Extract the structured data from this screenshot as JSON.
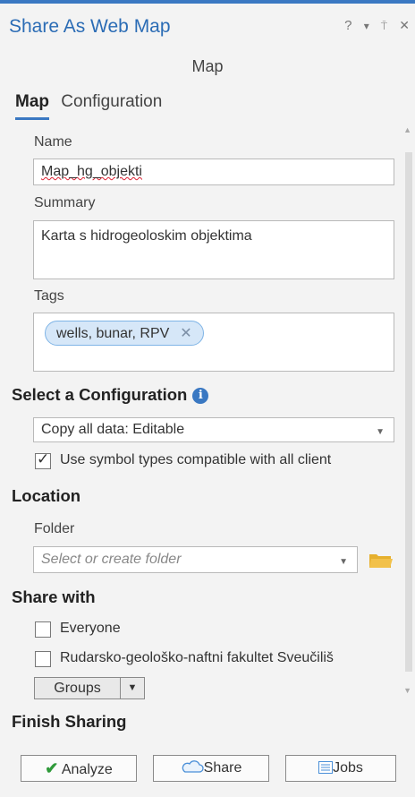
{
  "window": {
    "title": "Share As Web Map",
    "help": "?",
    "menu": "▾",
    "pin": "▣",
    "close": "✕"
  },
  "subtitle": "Map",
  "tabs": [
    {
      "label": "Map",
      "active": true
    },
    {
      "label": "Configuration",
      "active": false
    }
  ],
  "fields": {
    "name_label": "Name",
    "name_value": "Map_hg_objekti",
    "summary_label": "Summary",
    "summary_value": "Karta s hidrogeoloskim objektima",
    "tags_label": "Tags",
    "tag_value": "wells, bunar, RPV"
  },
  "configuration": {
    "heading": "Select a Configuration",
    "info_icon": "i",
    "selected": "Copy all data: Editable",
    "compatible_label": "Use symbol types compatible with all client",
    "compatible_checked": true
  },
  "location": {
    "heading": "Location",
    "folder_label": "Folder",
    "folder_placeholder": "Select or create folder"
  },
  "share_with": {
    "heading": "Share with",
    "options": [
      {
        "label": "Everyone",
        "checked": false
      },
      {
        "label": "Rudarsko-geološko-naftni fakultet Sveučiliš",
        "checked": false
      }
    ],
    "groups_button": "Groups"
  },
  "finish": {
    "heading": "Finish Sharing",
    "analyze": "Analyze",
    "share": "Share",
    "jobs": "Jobs"
  },
  "colors": {
    "accent": "#3a78c2",
    "background": "#f3f3f3",
    "tag_chip": "#d6e7f8",
    "folder_icon": "#e6b02e"
  }
}
